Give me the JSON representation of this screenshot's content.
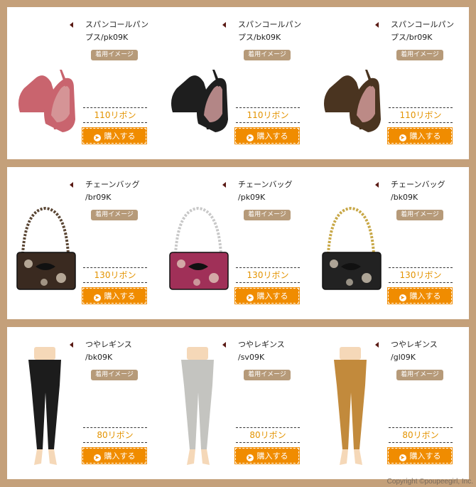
{
  "panels": [
    {
      "items": [
        {
          "name_line1": "スパンコールパン",
          "name_line2": "プス/pk09K",
          "badge": "着用イメージ",
          "price": "110リボン",
          "buy_label": "購入する",
          "color": "#c9646e",
          "icon": "pumps-icon"
        },
        {
          "name_line1": "スパンコールパン",
          "name_line2": "プス/bk09K",
          "badge": "着用イメージ",
          "price": "110リボン",
          "buy_label": "購入する",
          "color": "#1e1e1e",
          "icon": "pumps-icon"
        },
        {
          "name_line1": "スパンコールパン",
          "name_line2": "プス/br09K",
          "badge": "着用イメージ",
          "price": "110リボン",
          "buy_label": "購入する",
          "color": "#4a3420",
          "icon": "pumps-icon"
        }
      ]
    },
    {
      "items": [
        {
          "name_line1": "チェーンバッグ",
          "name_line2": "/br09K",
          "badge": "着用イメージ",
          "price": "130リボン",
          "buy_label": "購入する",
          "color": "#3a2a20",
          "chain": "#5a4634",
          "icon": "handbag-icon"
        },
        {
          "name_line1": "チェーンバッグ",
          "name_line2": "/pk09K",
          "badge": "着用イメージ",
          "price": "130リボン",
          "buy_label": "購入する",
          "color": "#a03058",
          "chain": "#c8c8c8",
          "icon": "handbag-icon"
        },
        {
          "name_line1": "チェーンバッグ",
          "name_line2": "/bk09K",
          "badge": "着用イメージ",
          "price": "130リボン",
          "buy_label": "購入する",
          "color": "#222222",
          "chain": "#c8a848",
          "icon": "handbag-icon"
        }
      ]
    },
    {
      "items": [
        {
          "name_line1": "つやレギンス",
          "name_line2": "/bk09K",
          "badge": "着用イメージ",
          "price": "80リボン",
          "buy_label": "購入する",
          "color": "#1c1c1c",
          "icon": "leggings-icon"
        },
        {
          "name_line1": "つやレギンス",
          "name_line2": "/sv09K",
          "badge": "着用イメージ",
          "price": "80リボン",
          "buy_label": "購入する",
          "color": "#c4c4c0",
          "icon": "leggings-icon"
        },
        {
          "name_line1": "つやレギンス",
          "name_line2": "/gl09K",
          "badge": "着用イメージ",
          "price": "80リボン",
          "buy_label": "購入する",
          "color": "#c28a3c",
          "icon": "leggings-icon"
        }
      ]
    }
  ],
  "copyright": "Copyright ©poupeegirl, Inc."
}
